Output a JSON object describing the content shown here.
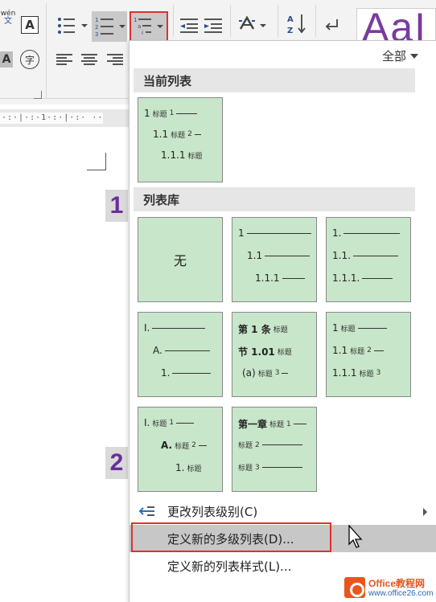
{
  "ribbon": {
    "wen_label": "wén",
    "wen_sub": "文",
    "char_border_label": "A",
    "shading_label": "A",
    "enclose_label": "字",
    "style_preview": "AaI"
  },
  "ruler": {
    "ticks": "·:·|·:·1·:·|·:· ··"
  },
  "doc": {
    "badge1": "1",
    "badge2": "2"
  },
  "menu": {
    "filter_label": "全部",
    "current_list_header": "当前列表",
    "library_header": "列表库",
    "current_tile": {
      "lines": [
        {
          "num": "1",
          "word": "标题",
          "lvl": "1"
        },
        {
          "num": "1.1",
          "word": "标题",
          "lvl": "2"
        },
        {
          "num": "1.1.1",
          "word": "标题",
          "lvl": ""
        }
      ]
    },
    "library": {
      "none_label": "无",
      "t2": [
        "1",
        "1.1",
        "1.1.1"
      ],
      "t3": [
        "1.",
        "1.1.",
        "1.1.1."
      ],
      "t4": [
        "I.",
        "A.",
        "1."
      ],
      "t5": [
        {
          "num": "第 1 条",
          "word": "标题",
          "lvl": ""
        },
        {
          "num": "节 1.01",
          "word": "标题",
          "lvl": ""
        },
        {
          "num": "(a)",
          "word": "标题",
          "lvl": "3"
        }
      ],
      "t6": [
        {
          "num": "1",
          "word": "标题",
          "lvl": ""
        },
        {
          "num": "1.1",
          "word": "标题",
          "lvl": "2"
        },
        {
          "num": "1.1.1",
          "word": "标题",
          "lvl": "3"
        }
      ],
      "t7": [
        {
          "num": "I.",
          "word": "标题",
          "lvl": "1"
        },
        {
          "num": "A.",
          "word": "标题",
          "lvl": "2"
        },
        {
          "num": "1.",
          "word": "标题",
          "lvl": ""
        }
      ],
      "t8": [
        {
          "num": "第一章",
          "word": "标题",
          "lvl": "1"
        },
        {
          "num": "",
          "word": "标题",
          "lvl": "2"
        },
        {
          "num": "",
          "word": "标题",
          "lvl": "3"
        }
      ]
    },
    "items": {
      "change_level": "更改列表级别(C)",
      "define_new_list": "定义新的多级列表(D)...",
      "define_new_style": "定义新的列表样式(L)..."
    }
  },
  "logo": {
    "name": "Office教程网",
    "url": "www.office26.com"
  },
  "colors": {
    "tile_green": "#c8e6c9",
    "highlight_red": "#e03030",
    "badge_purple": "#6a2e9a",
    "ribbon_blue": "#2f4e8c"
  }
}
